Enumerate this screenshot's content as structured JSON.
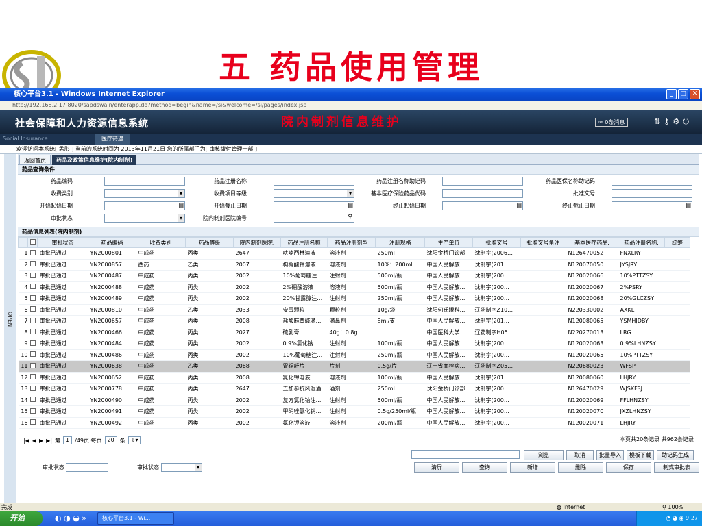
{
  "slide": {
    "title": "五 药品使用管理"
  },
  "ie": {
    "title": "核心平台3.1 - Windows Internet Explorer",
    "address": "http://192.168.2.17 8020/sapdswain/enterapp.do?method=begin&name=/si&welcome=/si/pages/index.jsp",
    "status_left": "完成",
    "status_zone": "Internet",
    "zoom": "100%"
  },
  "app": {
    "title": "社会保障和人力资源信息系统",
    "overlay_title": "院内制剂信息维护",
    "messages": "0条消息",
    "menu_left": "Social Insurance",
    "menu_tab": "医疗待遇",
    "welcome": "欢迎访问本系统[ 孟彤 ] 当前的系统时间为 2013年11月21日 您的所属部门为[ 审核拨付管理一部 ]"
  },
  "tabs": {
    "home": "返回首页",
    "active": "药品及政策信息维护(院内制剂)"
  },
  "side": {
    "open": "OPEN"
  },
  "query": {
    "section": "药品查询条件",
    "labels": [
      "药品编码",
      "药品注册名称",
      "药品注册名称助记码",
      "药品医保名称助记码",
      "收费类别",
      "收费项目等级",
      "基本医疗保险药品代码",
      "批准文号",
      "开始起始日期",
      "开始截止日期",
      "终止起始日期",
      "终止截止日期",
      "审批状态",
      "院内制剂医院编号"
    ]
  },
  "grid": {
    "section": "药品信息列表(院内制剂)",
    "headers": [
      "审批状态",
      "药品编码",
      "收费类别",
      "药品等级",
      "院内制剂医院.",
      "药品注册名称",
      "药品注册剂型",
      "注册规格",
      "生产单位",
      "批准文号",
      "批准文号备注",
      "基本医疗药品.",
      "药品注册名称.",
      "统筹"
    ],
    "rows": [
      [
        "1",
        "审批已通过",
        "YN2000801",
        "中成药",
        "丙类",
        "2647",
        "呋喃西林溶液",
        "溶液剂",
        "250ml",
        "沈阳金桥门诊部",
        "沈制字(2006…",
        "",
        "N126470052",
        "FNXLRY"
      ],
      [
        "2",
        "审批已通过",
        "YN2000857",
        "西药",
        "乙类",
        "2007",
        "枸橼酸钾溶液",
        "溶液剂",
        "10%：200ml…",
        "中国人民解放…",
        "沈制字(201…",
        "",
        "N120070050",
        "JYSJRY"
      ],
      [
        "3",
        "审批已通过",
        "YN2000487",
        "中成药",
        "丙类",
        "2002",
        "10%葡萄糖注…",
        "注射剂",
        "500ml/瓶",
        "中国人民解放…",
        "沈制字(200…",
        "",
        "N120020066",
        "10%PTTZSY"
      ],
      [
        "4",
        "审批已通过",
        "YN2000488",
        "中成药",
        "丙类",
        "2002",
        "2%硼酸溶液",
        "溶液剂",
        "500ml/瓶",
        "中国人民解放…",
        "沈制字(200…",
        "",
        "N120020067",
        "2%PSRY"
      ],
      [
        "5",
        "审批已通过",
        "YN2000489",
        "中成药",
        "丙类",
        "2002",
        "20%甘露醇注…",
        "注射剂",
        "250ml/瓶",
        "中国人民解放…",
        "沈制字(200…",
        "",
        "N120020068",
        "20%GLCZSY"
      ],
      [
        "6",
        "审批已通过",
        "YN2000810",
        "中成药",
        "乙类",
        "2033",
        "安雪颗粒",
        "颗粒剂",
        "10g/袋",
        "沈阳何氏眼科…",
        "辽药制字Z10…",
        "",
        "N220330002",
        "AXKL"
      ],
      [
        "7",
        "审批已通过",
        "YN2000657",
        "中成药",
        "丙类",
        "2008",
        "盐酸麻黄碱滴…",
        "滴鼻剂",
        "8ml/支",
        "中国人民解放…",
        "沈制字(201…",
        "",
        "N120080065",
        "YSMHJDBY"
      ],
      [
        "8",
        "审批已通过",
        "YN2000466",
        "中成药",
        "丙类",
        "2027",
        "硫乳膏",
        "40g：0.8g",
        "",
        "中国医科大学…",
        "辽药制字H05…",
        "",
        "N220270013",
        "LRG"
      ],
      [
        "9",
        "审批已通过",
        "YN2000484",
        "中成药",
        "丙类",
        "2002",
        "0.9%氯化钠…",
        "注射剂",
        "100ml/瓶",
        "中国人民解放…",
        "沈制字(200…",
        "",
        "N120020063",
        "0.9%LHNZSY"
      ],
      [
        "10",
        "审批已通过",
        "YN2000486",
        "中成药",
        "丙类",
        "2002",
        "10%葡萄糖注…",
        "注射剂",
        "250ml/瓶",
        "中国人民解放…",
        "沈制字(200…",
        "",
        "N120020065",
        "10%PTTZSY"
      ],
      [
        "11",
        "审批已通过",
        "YN2000638",
        "中成药",
        "乙类",
        "2068",
        "胃福舒片",
        "片剂",
        "0.5g/片",
        "辽宁省血栓病…",
        "辽药制字Z05…",
        "",
        "N220680023",
        "WFSP"
      ],
      [
        "12",
        "审批已通过",
        "YN2000652",
        "中成药",
        "丙类",
        "2008",
        "氯化钾溶液",
        "溶液剂",
        "100ml/瓶",
        "中国人民解放…",
        "沈制字(201…",
        "",
        "N120080060",
        "LHJRY"
      ],
      [
        "13",
        "审批已通过",
        "YN2000778",
        "中成药",
        "丙类",
        "2647",
        "五加参抗风湿酒",
        "酒剂",
        "250ml",
        "沈阳金桥门诊部",
        "沈制字(200…",
        "",
        "N126470029",
        "WJSKFSJ"
      ],
      [
        "14",
        "审批已通过",
        "YN2000490",
        "中成药",
        "丙类",
        "2002",
        "复方氯化钠注…",
        "注射剂",
        "500ml/瓶",
        "中国人民解放…",
        "沈制字(200…",
        "",
        "N120020069",
        "FFLHNZSY"
      ],
      [
        "15",
        "审批已通过",
        "YN2000491",
        "中成药",
        "丙类",
        "2002",
        "甲硝唑氯化钠…",
        "注射剂",
        "0.5g/250ml/瓶",
        "中国人民解放…",
        "沈制字(200…",
        "",
        "N120020070",
        "JXZLHNZSY"
      ],
      [
        "16",
        "审批已通过",
        "YN2000492",
        "中成药",
        "丙类",
        "2002",
        "氯化钾溶液",
        "溶液剂",
        "200ml/瓶",
        "中国人民解放…",
        "沈制字(200…",
        "",
        "N120020071",
        "LHJRY"
      ]
    ]
  },
  "pager": {
    "first": "第",
    "page": "1",
    "total": "/49页 每页",
    "size": "20",
    "per": "条",
    "summary": "本页共20条记录 共962条记录"
  },
  "bottom": {
    "label1": "审批状态",
    "label2": "审批状态",
    "row1": [
      "浏览",
      "取消",
      "批量导入",
      "模板下载",
      "助记码生成"
    ],
    "row2": [
      "清屏",
      "查询",
      "新增",
      "删除",
      "保存",
      "制式审批表"
    ]
  },
  "taskbar": {
    "start": "开始",
    "task": "核心平台3.1 - Wi...",
    "time": "9:27"
  }
}
